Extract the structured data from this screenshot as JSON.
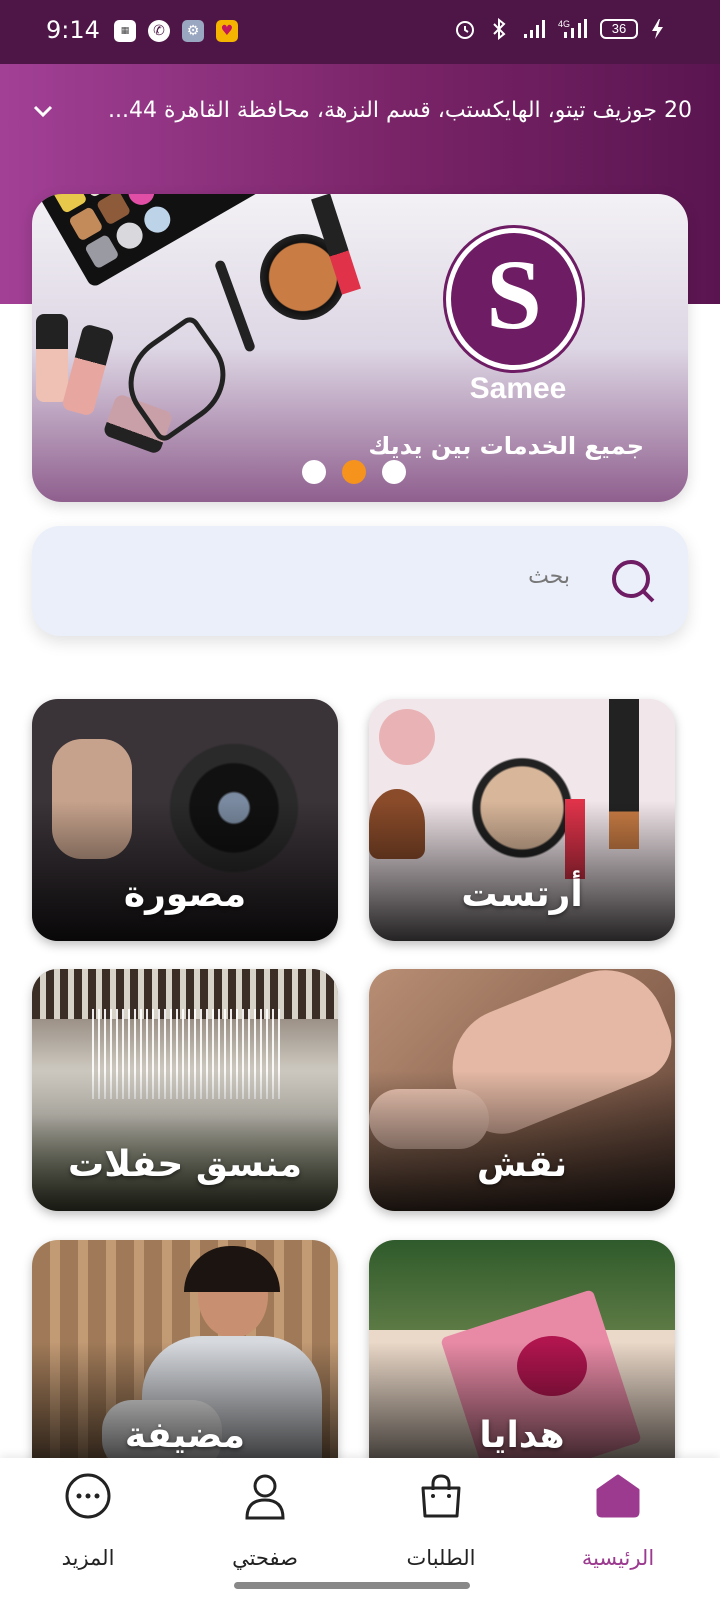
{
  "status_bar": {
    "time": "9:14",
    "battery": "36"
  },
  "header": {
    "address": "20 جوزيف تيتو، الهايكستب، قسم النزهة، محافظة القاهرة 44..."
  },
  "banner": {
    "logo_text": "Samee",
    "tagline": "جميع الخدمات بين يديك",
    "active_slide": 2,
    "slide_count": 3
  },
  "search": {
    "placeholder": "بحث"
  },
  "categories": [
    {
      "label": "أرتست"
    },
    {
      "label": "مصورة"
    },
    {
      "label": "نقش"
    },
    {
      "label": "منسق حفلات"
    },
    {
      "label": "هدايا"
    },
    {
      "label": "مضيفة"
    }
  ],
  "nav": {
    "home": "الرئيسية",
    "orders": "الطلبات",
    "profile": "صفحتي",
    "more": "المزيد"
  },
  "colors": {
    "brand": "#6e1c64",
    "accent": "#f6931d",
    "search_bg": "#eaeff9"
  },
  "icons": {
    "status_left": [
      "photo-icon",
      "phone-icon",
      "settings-app-icon",
      "emoji-icon"
    ],
    "status_right": [
      "alarm-icon",
      "bluetooth-icon",
      "signal-icon",
      "4g-signal-icon",
      "battery-icon",
      "charging-icon"
    ],
    "search": "search-icon",
    "chevron": "chevron-down-icon",
    "nav": [
      "home-icon",
      "bag-icon",
      "user-icon",
      "more-icon"
    ]
  }
}
